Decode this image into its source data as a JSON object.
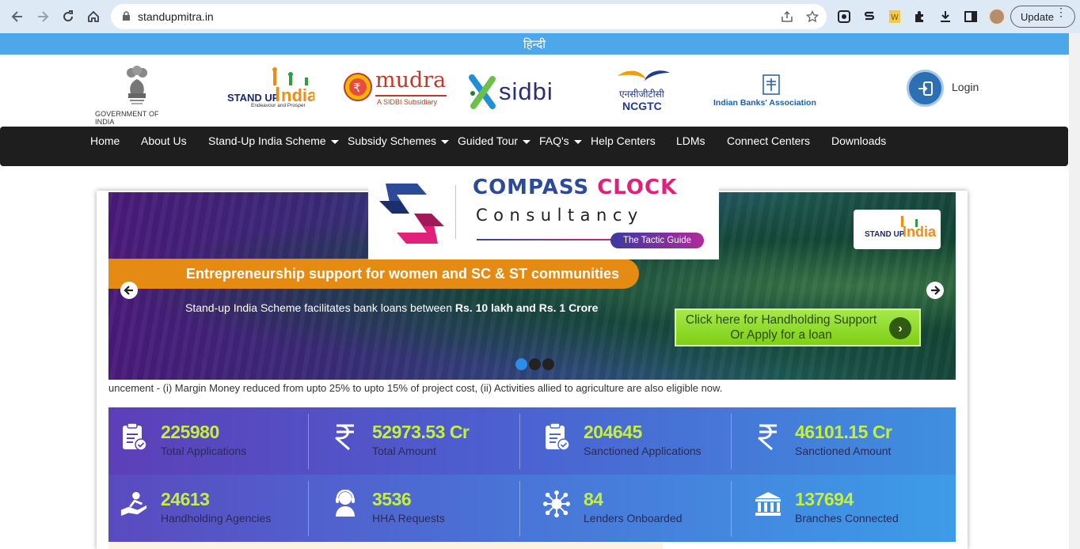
{
  "browser": {
    "url": "standupmitra.in",
    "update_label": "Update"
  },
  "langbar": {
    "label": "हिन्दी"
  },
  "logos": {
    "goi": "GOVERNMENT OF INDIA",
    "standup_tagline": "Endeavour and Prosper",
    "mudra_text": "mudra",
    "mudra_sub": "A SIDBI Subsidiary",
    "sidbi": "sidbi",
    "ncgtc_hindi": "एनसीजीटीसी",
    "ncgtc": "NCGTC",
    "iba": "Indian Banks' Association"
  },
  "login": {
    "label": "Login"
  },
  "nav": {
    "items": [
      {
        "label": "Home"
      },
      {
        "label": "About Us"
      },
      {
        "label": "Stand-Up India Scheme"
      },
      {
        "label": "Subsidy Schemes"
      },
      {
        "label": "Guided Tour"
      },
      {
        "label": "FAQ's"
      },
      {
        "label": "Help Centers"
      },
      {
        "label": "LDMs"
      },
      {
        "label": "Connect Centers"
      },
      {
        "label": "Downloads"
      }
    ]
  },
  "compass": {
    "title_part1": "COMPASS",
    "title_part2": "CLOCK",
    "subtitle": "Consultancy",
    "tag": "The Tactic Guide"
  },
  "banner": {
    "headline": "Entrepreneurship support for women and SC & ST communities",
    "sub_prefix": "Stand-up India Scheme facilitates bank loans between ",
    "sub_bold": "Rs. 10 lakh and Rs. 1 Crore",
    "apply_line1": "Click here for Handholding Support",
    "apply_line2": "Or Apply for a loan"
  },
  "ticker": {
    "text": "uncement - (i) Margin Money reduced from upto 25% to upto 15% of project cost, (ii) Activities allied to agriculture are also eligible now."
  },
  "stats": [
    {
      "value": "225980",
      "label": "Total Applications",
      "icon": "clipboard-check-icon"
    },
    {
      "value": "52973.53 Cr",
      "label": "Total Amount",
      "icon": "rupee-icon"
    },
    {
      "value": "204645",
      "label": "Sanctioned Applications",
      "icon": "clipboard-check-icon"
    },
    {
      "value": "46101.15 Cr",
      "label": "Sanctioned Amount",
      "icon": "rupee-icon"
    },
    {
      "value": "24613",
      "label": "Handholding Agencies",
      "icon": "hand-support-icon"
    },
    {
      "value": "3536",
      "label": "HHA Requests",
      "icon": "support-agent-icon"
    },
    {
      "value": "84",
      "label": "Lenders Onboarded",
      "icon": "network-icon"
    },
    {
      "value": "137694",
      "label": "Branches Connected",
      "icon": "bank-icon"
    }
  ],
  "colors": {
    "langbar": "#4da7e8",
    "nav_bg": "#1e1e1e",
    "banner_headline": "#e58a13",
    "stat_value": "#c5f03a",
    "apply_button": "#8fdb2a"
  }
}
